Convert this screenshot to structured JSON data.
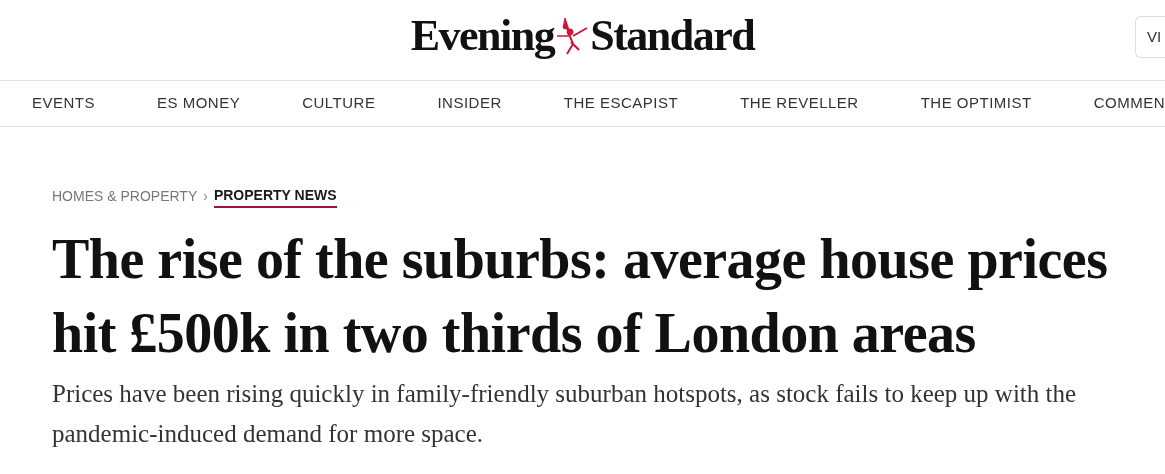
{
  "masthead": {
    "logo": [
      "Evening",
      "Standard"
    ],
    "button": "VI"
  },
  "nav": [
    "EVENTS",
    "ES MONEY",
    "CULTURE",
    "INSIDER",
    "THE ESCAPIST",
    "THE REVELLER",
    "THE OPTIMIST",
    "COMMEN"
  ],
  "breadcrumb": [
    {
      "label": "HOMES & PROPERTY",
      "selected": false
    },
    {
      "label": "PROPERTY NEWS",
      "selected": true
    }
  ],
  "breadcrumb_separator": "›",
  "headline": "The rise of the suburbs: average house prices hit £500k in two thirds of London areas",
  "standfirst": "Prices have been rising quickly in family-friendly suburban hotspots, as stock fails to keep up with the pandemic-induced demand for more space."
}
